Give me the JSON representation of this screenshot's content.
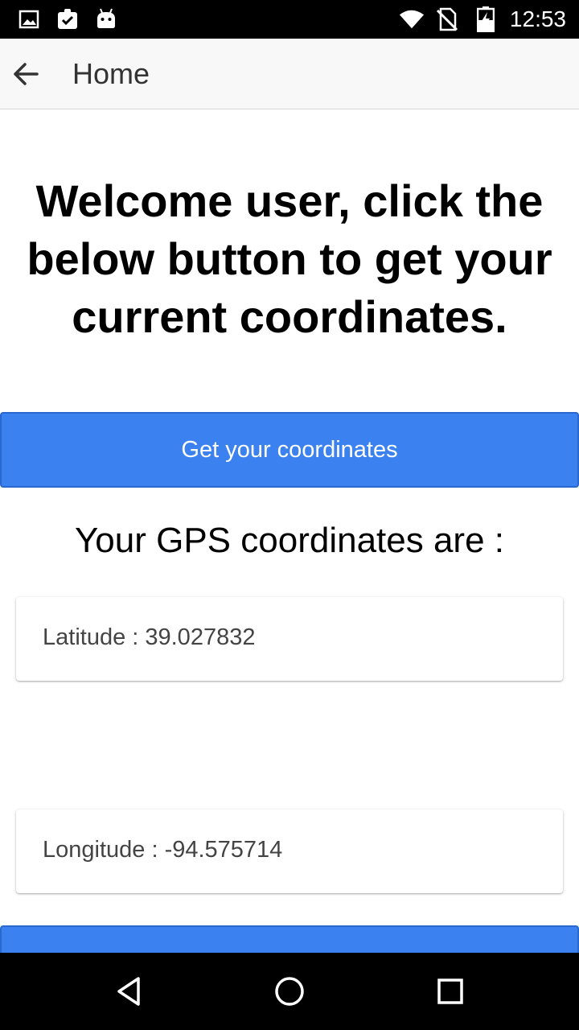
{
  "status_bar": {
    "time": "12:53",
    "icons": [
      "image-icon",
      "clipboard-check-icon",
      "android-icon",
      "wifi-icon",
      "no-sim-icon",
      "battery-charging-icon"
    ]
  },
  "app_bar": {
    "title": "Home",
    "back_icon": "arrow-left-icon"
  },
  "main": {
    "welcome_text": "Welcome user, click the below button to get your current coordinates.",
    "get_button_label": "Get your coordinates",
    "coords_heading": "Your GPS coordinates are :",
    "latitude_text": "Latitude : 39.027832",
    "longitude_text": "Longitude : -94.575714"
  },
  "colors": {
    "primary_button": "#3b81f0",
    "status_bar": "#000000",
    "app_bar": "#f8f8f8"
  },
  "nav_bar": {
    "icons": [
      "back-triangle-icon",
      "home-circle-icon",
      "recents-square-icon"
    ]
  }
}
